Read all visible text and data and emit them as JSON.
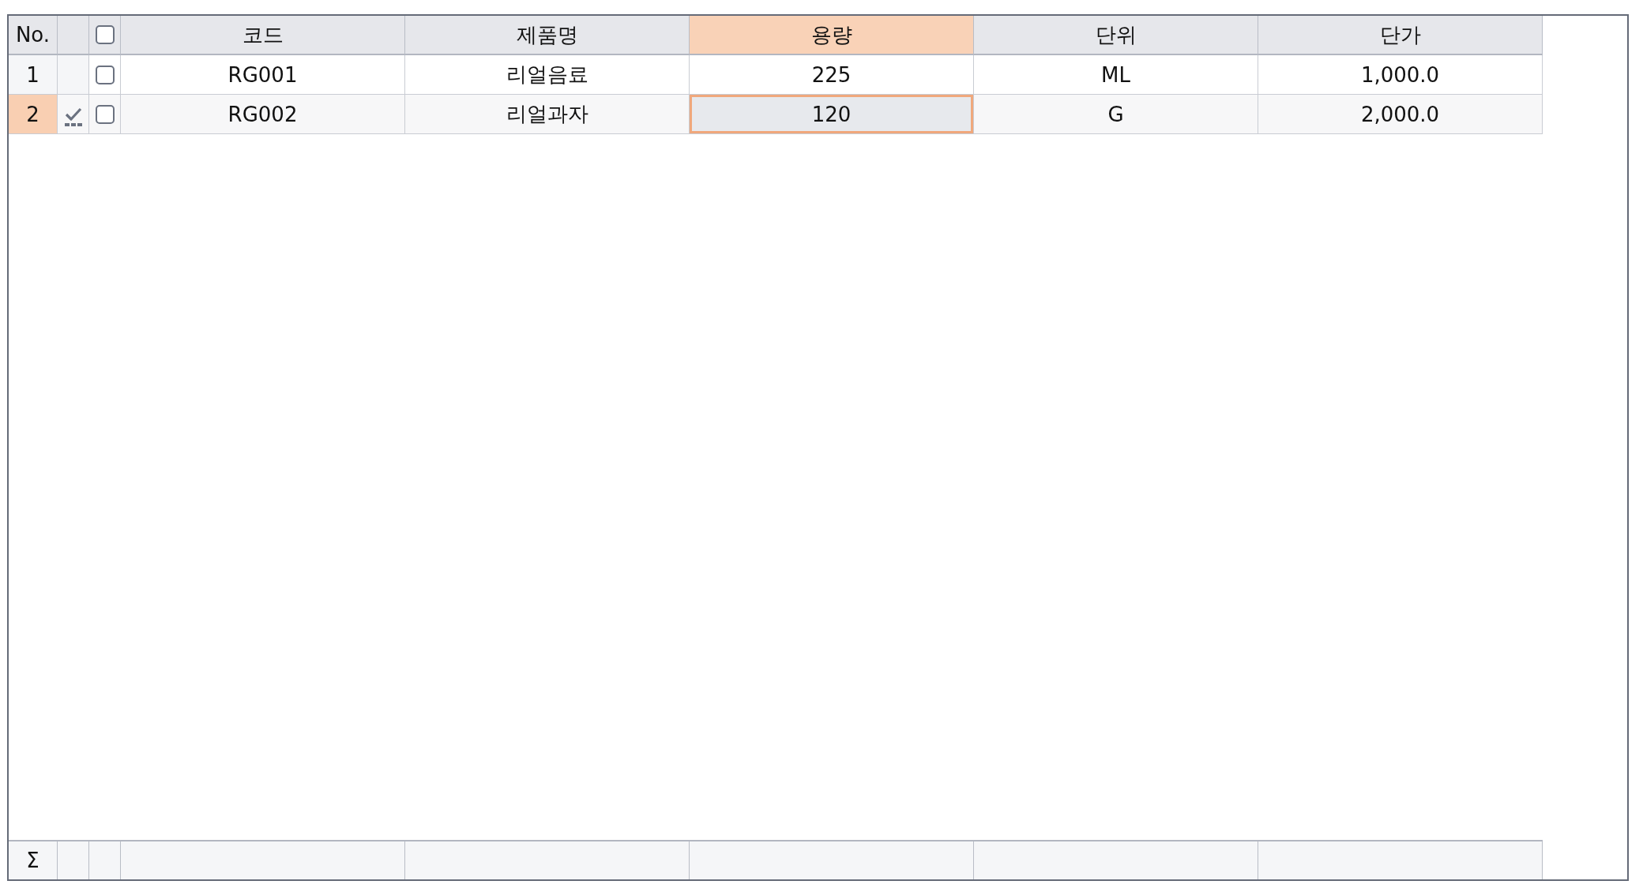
{
  "grid": {
    "header": {
      "row_number": "No.",
      "select_all_checked": false
    },
    "columns": [
      {
        "label": "코드",
        "selected": false
      },
      {
        "label": "제품명",
        "selected": false
      },
      {
        "label": "용량",
        "selected": true
      },
      {
        "label": "단위",
        "selected": false
      },
      {
        "label": "단가",
        "selected": false
      }
    ],
    "rows": [
      {
        "number": "1",
        "modified": false,
        "checked": false,
        "selected": false,
        "cells": [
          "RG001",
          "리얼음료",
          "225",
          "ML",
          "1,000.0"
        ]
      },
      {
        "number": "2",
        "modified": true,
        "checked": false,
        "selected": true,
        "cells": [
          "RG002",
          "리얼과자",
          "120",
          "G",
          "2,000.0"
        ]
      }
    ],
    "summary": {
      "label": "Σ"
    }
  }
}
